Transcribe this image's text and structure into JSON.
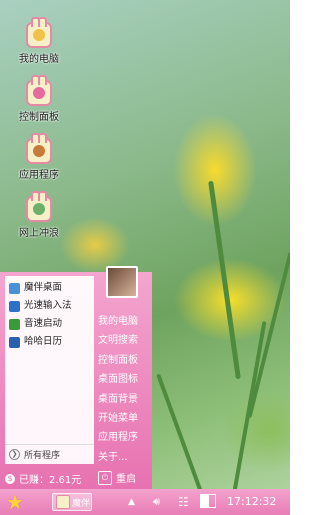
{
  "desktop": {
    "icons": [
      {
        "label": "我的电脑"
      },
      {
        "label": "控制面板"
      },
      {
        "label": "应用程序"
      },
      {
        "label": "网上冲浪"
      }
    ]
  },
  "start_menu": {
    "apps": [
      {
        "label": "魔伴桌面",
        "color": "#4a90d9"
      },
      {
        "label": "光速输入法",
        "color": "#2e6fc9"
      },
      {
        "label": "音速启动",
        "color": "#3a9a3a"
      },
      {
        "label": "哈哈日历",
        "color": "#2b5fb0"
      }
    ],
    "all_programs": "所有程序",
    "links": [
      "我的电脑",
      "文明搜索",
      "控制面板",
      "桌面图标",
      "桌面背景",
      "开始菜单",
      "应用程序",
      "关于..."
    ],
    "earned": "已赚：2.61元",
    "restart": "重启"
  },
  "taskbar": {
    "task_label": "魔伴",
    "clock": "17:12:32",
    "colors": {
      "accent": "#e87db6"
    }
  }
}
